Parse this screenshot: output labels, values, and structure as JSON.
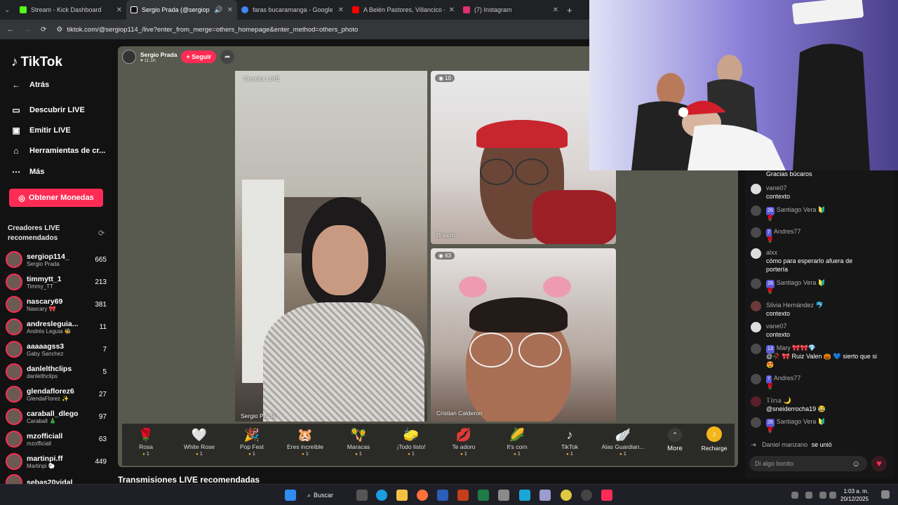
{
  "browser": {
    "tabs": [
      {
        "label": "Stream - Kick Dashboard",
        "color": "#53fc18"
      },
      {
        "label": "Sergio Prada (@sergiop114)",
        "color": "#ffffff"
      },
      {
        "label": "faras bucaramanga - Google Se",
        "color": "#4285f4"
      },
      {
        "label": "A Belén Pastores, Villancico - M",
        "color": "#ff0000"
      },
      {
        "label": "(7) Instagram",
        "color": "#e1306c"
      }
    ],
    "new_tab": "+",
    "url": "tiktok.com/@sergiop114_/live?enter_from_merge=others_homepage&enter_method=others_photo"
  },
  "sidebar": {
    "logo": "TikTok",
    "back": "Atrás",
    "nav": [
      {
        "label": "Descubrir LIVE",
        "icon": "tv-icon"
      },
      {
        "label": "Emitir LIVE",
        "icon": "camera-icon"
      },
      {
        "label": "Herramientas de cr...",
        "icon": "home-icon"
      },
      {
        "label": "Más",
        "icon": "more-icon"
      }
    ],
    "coins_button": "Obtener Monedas",
    "recommended_title": "Creadores LIVE recomendados",
    "creators": [
      {
        "handle": "sergiop114_",
        "name": "Sergio Prada",
        "count": "665"
      },
      {
        "handle": "timmytt_1",
        "name": "Timmy_TT",
        "count": "213"
      },
      {
        "handle": "nascary69",
        "name": "Nascary 🎀",
        "count": "381"
      },
      {
        "handle": "andresleguia...",
        "name": "Andrés Leguia 🐝",
        "count": "11"
      },
      {
        "handle": "aaaaagss3",
        "name": "Gaby Sanchez",
        "count": "7"
      },
      {
        "handle": "danlelthclips",
        "name": "danlelthclips",
        "count": "5"
      },
      {
        "handle": "glendaflorez6",
        "name": "GlendaFlorez ✨",
        "count": "27"
      },
      {
        "handle": "caraball_dlego",
        "name": "Caraball 🎄",
        "count": "97"
      },
      {
        "handle": "mzofficiall",
        "name": "mzofficiall",
        "count": "63"
      },
      {
        "handle": "martinpi.ff",
        "name": "Martinpi 🐑",
        "count": "449"
      },
      {
        "handle": "sebas20vidal",
        "name": "",
        "count": ""
      }
    ]
  },
  "stage": {
    "host_name": "Sergio Prada",
    "host_likes": "♥ 11.1K",
    "follow": "+ Seguir",
    "panels": {
      "main_label": "Creador LIVE",
      "main_name": "Sergio Prada",
      "p2_name": "Briiann.",
      "p2_badge": "10",
      "p3_name": "Cristian Calderon",
      "p3_badge": "63"
    }
  },
  "gifts": [
    {
      "name": "Rosa",
      "price": "1",
      "icon": "🌹"
    },
    {
      "name": "White Rose",
      "price": "1",
      "icon": "🤍"
    },
    {
      "name": "Pop Fest",
      "price": "1",
      "icon": "🎉"
    },
    {
      "name": "Eres increíble",
      "price": "1",
      "icon": "🐹"
    },
    {
      "name": "Maracas",
      "price": "1",
      "icon": "🪇"
    },
    {
      "name": "¡Todo listo!",
      "price": "1",
      "icon": "🧽"
    },
    {
      "name": "Te adoro",
      "price": "1",
      "icon": "💋"
    },
    {
      "name": "It's corn",
      "price": "1",
      "icon": "🌽"
    },
    {
      "name": "TikTok",
      "price": "1",
      "icon": "♪"
    },
    {
      "name": "Alas Guardian...",
      "price": "1",
      "icon": "🪽"
    }
  ],
  "gift_more": "More",
  "recharge": "Recharge",
  "recommended_bottom": "Transmisiones LIVE recomendadas",
  "chat": {
    "messages": [
      {
        "user": "",
        "text": "Gracias búcaros",
        "level": ""
      },
      {
        "user": "vane07",
        "text": "contexto",
        "level": ""
      },
      {
        "user": "Santiago Vera 🔰",
        "text": "🌹",
        "level": "26"
      },
      {
        "user": "Andres77",
        "text": "🌹",
        "level": "7"
      },
      {
        "user": "alxx",
        "text": "cómo para esperarlo afuera de portería",
        "level": ""
      },
      {
        "user": "Santiago Vera 🔰",
        "text": "🌹",
        "level": "26"
      },
      {
        "user": "Silvia Hernández 🐬",
        "text": "contexto",
        "level": ""
      },
      {
        "user": "vane07",
        "text": "contexto",
        "level": ""
      },
      {
        "user": "Mary 🎀🎀💎",
        "text": "@🥀 🎀 Ruiz Valen 🎃 💙 sierto que si 😍",
        "level": "13"
      },
      {
        "user": "Andres77",
        "text": "🌹",
        "level": "7"
      },
      {
        "user": "𝕋𝕚𝕟𝕒 🌙",
        "text": "@sneiderrocha19 😂",
        "level": ""
      },
      {
        "user": "Santiago Vera 🔰",
        "text": "🌹",
        "level": "26"
      },
      {
        "user": "Daniel manzano",
        "text": "se unió",
        "level": ""
      }
    ],
    "input_placeholder": "Di algo bonito"
  },
  "taskbar": {
    "search": "Buscar",
    "time": "1:03 a. m.",
    "date": "20/12/2025"
  }
}
